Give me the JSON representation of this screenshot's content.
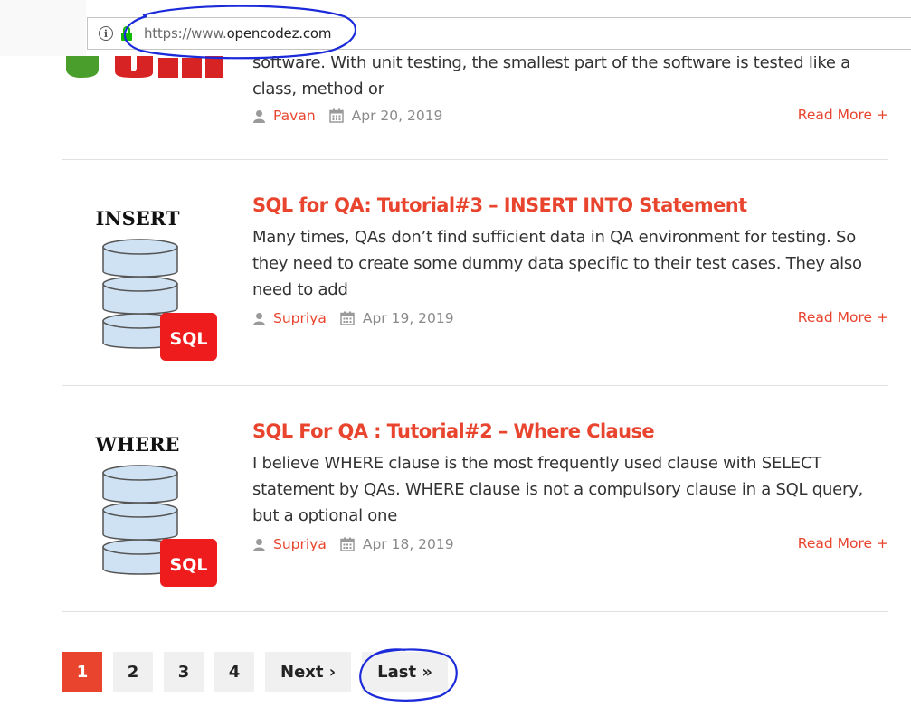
{
  "browser": {
    "url_scheme": "https://www.",
    "url_domain": "opencodez.com"
  },
  "articles": [
    {
      "excerpt": "software. With unit testing, the smallest part of the software is tested like a class, method or",
      "author": "Pavan",
      "date": "Apr 20, 2019",
      "read_more": "Read More +"
    },
    {
      "thumb_label": "INSERT",
      "thumb_badge": "SQL",
      "title": "SQL for QA: Tutorial#3 – INSERT INTO Statement",
      "excerpt": "Many times, QAs don’t find sufficient data in QA environment for testing. So they need to create some dummy data specific to their test cases. They also need to add",
      "author": "Supriya",
      "date": "Apr 19, 2019",
      "read_more": "Read More +"
    },
    {
      "thumb_label": "WHERE",
      "thumb_badge": "SQL",
      "title": "SQL For QA : Tutorial#2 – Where Clause",
      "excerpt": "I believe WHERE clause is the most frequently used clause with SELECT statement by QAs. WHERE clause is not a compulsory clause in a SQL query, but a optional one",
      "author": "Supriya",
      "date": "Apr 18, 2019",
      "read_more": "Read More +"
    }
  ],
  "pagination": {
    "pages": [
      "1",
      "2",
      "3",
      "4"
    ],
    "current": "1",
    "next": "Next ›",
    "last": "Last »"
  },
  "colors": {
    "accent": "#e8442e",
    "annotation": "#1c2bd9",
    "lock": "#12bc00"
  },
  "icons": [
    "info-icon",
    "lock-icon",
    "user-icon",
    "calendar-icon",
    "database-icon"
  ]
}
